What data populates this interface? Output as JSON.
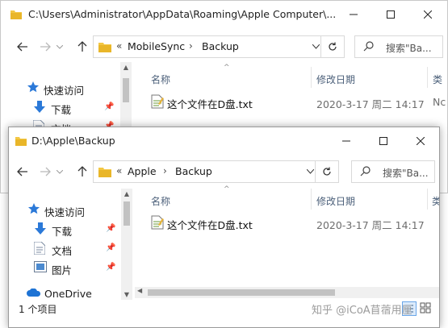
{
  "back_window": {
    "title": "C:\\Users\\Administrator\\AppData\\Roaming\\Apple Computer\\...",
    "address": {
      "overflow": "«",
      "segments": [
        "MobileSync",
        "Backup"
      ]
    },
    "search_placeholder": "搜索\"Ba...",
    "nav_items": [
      {
        "label": "快速访问"
      },
      {
        "label": "下载"
      },
      {
        "label": "文档"
      }
    ],
    "columns": [
      "名称",
      "修改日期",
      "类"
    ],
    "files": [
      {
        "name": "这个文件在D盘.txt",
        "date": "2020-3-17 周二 14:17",
        "type": "Nc"
      }
    ]
  },
  "front_window": {
    "title": "D:\\Apple\\Backup",
    "address": {
      "overflow": "«",
      "segments": [
        "Apple",
        "Backup"
      ]
    },
    "search_placeholder": "搜索\"Ba...",
    "nav_items": [
      {
        "label": "快速访问"
      },
      {
        "label": "下载"
      },
      {
        "label": "文档"
      },
      {
        "label": "图片"
      },
      {
        "label": "OneDrive"
      }
    ],
    "columns": [
      "名称",
      "修改日期",
      "类"
    ],
    "files": [
      {
        "name": "这个文件在D盘.txt",
        "date": "2020-3-17 周二 14:17"
      }
    ],
    "status": "1 个项目"
  },
  "watermark": "知乎 @iCoA苜蓿用厘",
  "icons": {
    "caption": [
      "minimize-icon",
      "maximize-icon",
      "close-icon"
    ],
    "nav": [
      "back-arrow-icon",
      "forward-arrow-icon",
      "recent-dropdown-icon",
      "up-arrow-icon"
    ]
  },
  "colors": {
    "folder": "#f3c744",
    "accent": "#1e73d4",
    "column_header": "#4c607a"
  }
}
